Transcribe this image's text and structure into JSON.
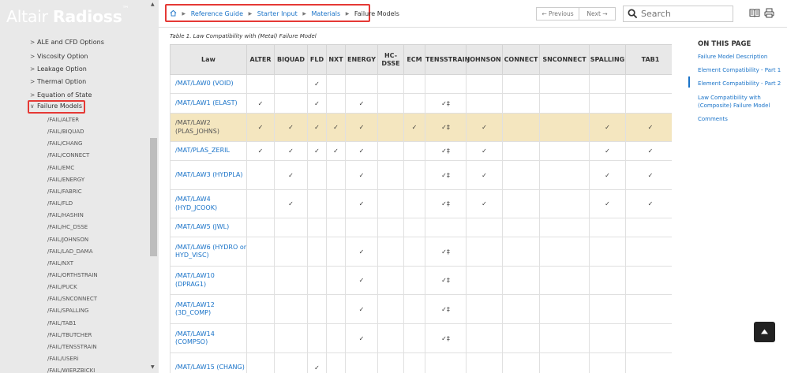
{
  "brand": {
    "normal": "Altair ",
    "bold": "Radioss",
    "tm": "™"
  },
  "sidebar": {
    "items": [
      {
        "label": "ALE and CFD Options",
        "expanded": false
      },
      {
        "label": "Viscosity Option",
        "expanded": false
      },
      {
        "label": "Leakage Option",
        "expanded": false
      },
      {
        "label": "Thermal Option",
        "expanded": false
      },
      {
        "label": "Equation of State",
        "expanded": false
      },
      {
        "label": "Failure Models",
        "expanded": true
      }
    ],
    "subitems": [
      "/FAIL/ALTER",
      "/FAIL/BIQUAD",
      "/FAIL/CHANG",
      "/FAIL/CONNECT",
      "/FAIL/EMC",
      "/FAIL/ENERGY",
      "/FAIL/FABRIC",
      "/FAIL/FLD",
      "/FAIL/HASHIN",
      "/FAIL/HC_DSSE",
      "/FAIL/JOHNSON",
      "/FAIL/LAD_DAMA",
      "/FAIL/NXT",
      "/FAIL/ORTHSTRAIN",
      "/FAIL/PUCK",
      "/FAIL/SNCONNECT",
      "/FAIL/SPALLING",
      "/FAIL/TAB1",
      "/FAIL/TBUTCHER",
      "/FAIL/TENSSTRAIN",
      "/FAIL/USERi",
      "/FAIL/WIERZBICKI"
    ]
  },
  "breadcrumb": [
    "Reference Guide",
    "Starter Input",
    "Materials",
    "Failure Models"
  ],
  "nav": {
    "previous": "← Previous",
    "next": "Next →"
  },
  "search": {
    "placeholder": "Search"
  },
  "table": {
    "caption": "Table 1. Law Compatibility with (Metal) Failure Model",
    "headers": [
      "Law",
      "ALTER",
      "BIQUAD",
      "FLD",
      "NXT",
      "ENERGY",
      "HC-DSSE",
      "ECM",
      "TENSSTRAIN",
      "JOHNSON",
      "CONNECT",
      "SNCONNECT",
      "SPALLING",
      "TAB1"
    ],
    "rows": [
      {
        "law": "/MAT/LAW0 (VOID)",
        "cells": [
          "",
          "",
          "✓",
          "",
          "",
          "",
          "",
          "",
          "",
          "",
          "",
          "",
          ""
        ],
        "highlight": false
      },
      {
        "law": "/MAT/LAW1 (ELAST)",
        "cells": [
          "✓",
          "",
          "✓",
          "",
          "✓",
          "",
          "",
          "✓‡",
          "",
          "",
          "",
          "",
          ""
        ],
        "highlight": false
      },
      {
        "law": "/MAT/LAW2 (PLAS_JOHNS)",
        "cells": [
          "✓",
          "✓",
          "✓",
          "✓",
          "✓",
          "",
          "✓",
          "✓‡",
          "✓",
          "",
          "",
          "✓",
          "✓"
        ],
        "highlight": true
      },
      {
        "law": "/MAT/PLAS_ZERIL",
        "cells": [
          "✓",
          "✓",
          "✓",
          "✓",
          "✓",
          "",
          "",
          "✓‡",
          "✓",
          "",
          "",
          "✓",
          "✓"
        ],
        "highlight": false
      },
      {
        "law": "/MAT/LAW3 (HYDPLA)",
        "cells": [
          "",
          "✓",
          "",
          "",
          "✓",
          "",
          "",
          "✓‡",
          "✓",
          "",
          "",
          "✓",
          "✓"
        ],
        "highlight": false
      },
      {
        "law": "/MAT/LAW4 (HYD_JCOOK)",
        "cells": [
          "",
          "✓",
          "",
          "",
          "✓",
          "",
          "",
          "✓‡",
          "✓",
          "",
          "",
          "✓",
          "✓"
        ],
        "highlight": false
      },
      {
        "law": "/MAT/LAW5 (JWL)",
        "cells": [
          "",
          "",
          "",
          "",
          "",
          "",
          "",
          "",
          "",
          "",
          "",
          "",
          ""
        ],
        "highlight": false
      },
      {
        "law": "/MAT/LAW6 (HYDRO or HYD_VISC)",
        "cells": [
          "",
          "",
          "",
          "",
          "✓",
          "",
          "",
          "✓‡",
          "",
          "",
          "",
          "",
          ""
        ],
        "highlight": false
      },
      {
        "law": "/MAT/LAW10 (DPRAG1)",
        "cells": [
          "",
          "",
          "",
          "",
          "✓",
          "",
          "",
          "✓‡",
          "",
          "",
          "",
          "",
          ""
        ],
        "highlight": false
      },
      {
        "law": "/MAT/LAW12 (3D_COMP)",
        "cells": [
          "",
          "",
          "",
          "",
          "✓",
          "",
          "",
          "✓‡",
          "",
          "",
          "",
          "",
          ""
        ],
        "highlight": false
      },
      {
        "law": "/MAT/LAW14 (COMPSO)",
        "cells": [
          "",
          "",
          "",
          "",
          "✓",
          "",
          "",
          "✓‡",
          "",
          "",
          "",
          "",
          ""
        ],
        "highlight": false
      },
      {
        "law": "/MAT/LAW15 (CHANG)",
        "cells": [
          "",
          "",
          "✓",
          "",
          "",
          "",
          "",
          "",
          "",
          "",
          "",
          "",
          ""
        ],
        "highlight": false
      }
    ]
  },
  "on_this_page": {
    "title": "ON THIS PAGE",
    "links": [
      "Failure Model Description",
      "Element Compatibility - Part 1",
      "Element Compatibility - Part 2",
      "Law Compatibility with (Composite) Failure Model",
      "Comments"
    ]
  },
  "colors": {
    "link": "#1a73c8",
    "highlight_row": "#f4e6bf",
    "annotation_box": "#e53935",
    "sidebar_bg": "#e9e9e9"
  }
}
